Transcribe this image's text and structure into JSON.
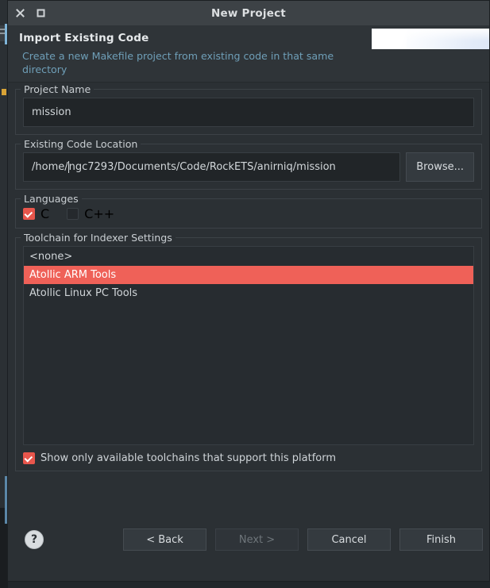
{
  "window": {
    "title": "New Project",
    "close_icon": "close-icon",
    "maximize_icon": "maximize-icon"
  },
  "wizard_header": {
    "title": "Import Existing Code",
    "description": "Create a new Makefile project from existing code in that same directory"
  },
  "project_name": {
    "group_label": "Project Name",
    "value": "mission",
    "placeholder": ""
  },
  "code_location": {
    "group_label": "Existing Code Location",
    "value_before_caret": "/home/",
    "value_after_caret": "ngc7293/Documents/Code/RockETS/anirniq/mission",
    "full_value": "/home/ngc7293/Documents/Code/RockETS/anirniq/mission",
    "browse_label": "Browse...",
    "placeholder": ""
  },
  "languages": {
    "group_label": "Languages",
    "items": [
      {
        "label": "C",
        "checked": true
      },
      {
        "label": "C++",
        "checked": false
      }
    ]
  },
  "toolchain": {
    "group_label": "Toolchain for Indexer Settings",
    "items": [
      {
        "label": "<none>",
        "selected": false
      },
      {
        "label": "Atollic ARM Tools",
        "selected": true
      },
      {
        "label": "Atollic Linux PC Tools",
        "selected": false
      }
    ],
    "show_only_available": {
      "label": "Show only available toolchains that support this platform",
      "checked": true
    }
  },
  "footer": {
    "help_label": "?",
    "buttons": [
      {
        "label": "< Back",
        "enabled": true
      },
      {
        "label": "Next >",
        "enabled": false
      },
      {
        "label": "Cancel",
        "enabled": true
      },
      {
        "label": "Finish",
        "enabled": true
      }
    ]
  },
  "colors": {
    "accent_red": "#ef6158",
    "checkbox_red": "#e8564c",
    "description_blue": "#6f9fb8",
    "dialog_bg": "#2b3034",
    "titlebar_bg": "#3d4246",
    "field_bg": "#212528"
  }
}
